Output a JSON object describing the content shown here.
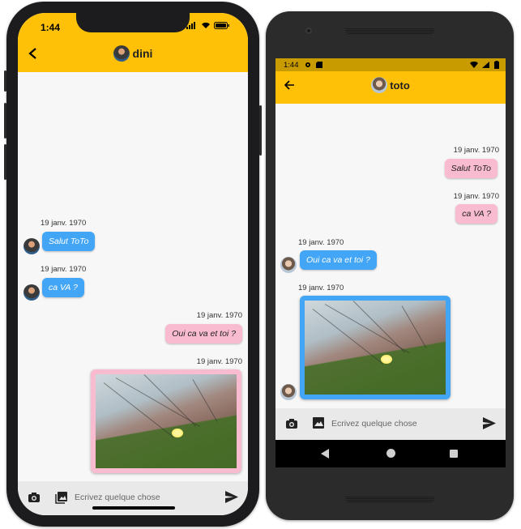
{
  "iphone": {
    "status_time": "1:44",
    "contact_name": "dini",
    "composer_placeholder": "Ecrivez quelque chose",
    "messages": [
      {
        "date": "19 janv. 1970",
        "text": "Salut ToTo",
        "side": "left"
      },
      {
        "date": "19 janv. 1970",
        "text": "ca VA ?",
        "side": "left"
      },
      {
        "date": "19 janv. 1970",
        "text": "Oui ca va et toi ?",
        "side": "right"
      },
      {
        "date": "19 janv. 1970",
        "text": "",
        "side": "right",
        "type": "image"
      }
    ]
  },
  "android": {
    "status_time": "1:44",
    "contact_name": "toto",
    "composer_placeholder": "Ecrivez quelque chose",
    "messages": [
      {
        "date": "19 janv. 1970",
        "text": "Salut ToTo",
        "side": "right"
      },
      {
        "date": "19 janv. 1970",
        "text": "ca VA ?",
        "side": "right"
      },
      {
        "date": "19 janv. 1970",
        "text": "Oui ca va et toi ?",
        "side": "left"
      },
      {
        "date": "19 janv. 1970",
        "text": "",
        "side": "left",
        "type": "image"
      }
    ]
  },
  "colors": {
    "app_bar": "#ffc107",
    "sent_bubble": "#f8bbd0",
    "received_bubble": "#42a5f5",
    "composer_bg": "#e9e9e9",
    "background": "#f7f7f7"
  },
  "icons": {
    "back": "arrow-back-icon",
    "camera": "camera-icon",
    "gallery": "image-icon",
    "send": "send-icon"
  }
}
